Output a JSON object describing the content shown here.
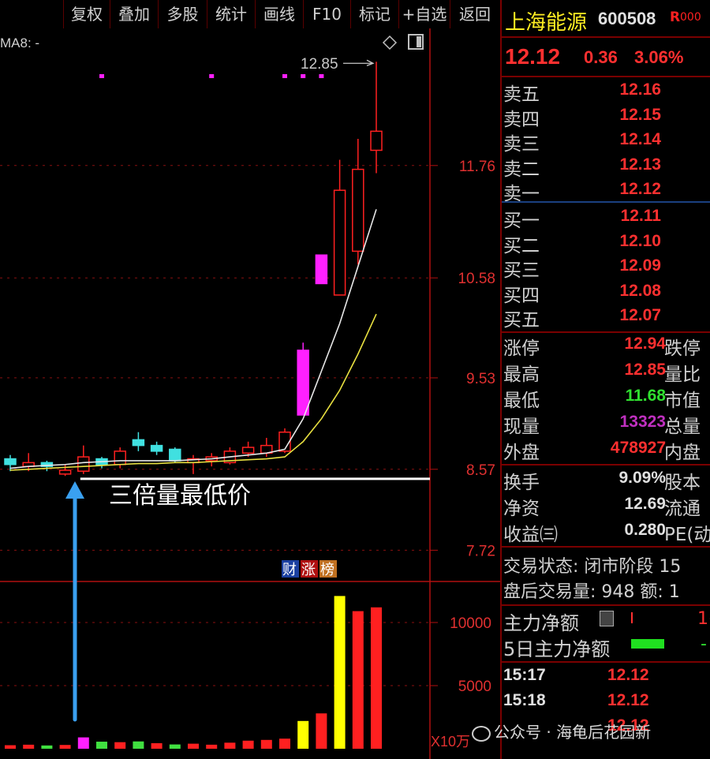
{
  "toolbar": {
    "buttons": [
      "复权",
      "叠加",
      "多股",
      "统计",
      "画线",
      "F10",
      "标记",
      "+自选",
      "返回"
    ]
  },
  "chart": {
    "ma_label": "MA8: -",
    "peak_label": "12.85",
    "price_ticks": [
      "11.76",
      "10.58",
      "9.53",
      "8.57",
      "7.72"
    ],
    "volume_ticks": [
      "10000",
      "5000"
    ],
    "volume_unit": "X10万",
    "annotation": "三倍量最低价",
    "badge": {
      "cai": "财",
      "zhang": "涨",
      "bang": "榜"
    },
    "colors": {
      "up": "#ff2020",
      "down": "#40e0e0",
      "ma_white": "#e8e8e8",
      "ma_yellow": "#e8e040",
      "volume_spike": "#ff20ff",
      "arrow": "#3aa0f0"
    }
  },
  "chart_data": {
    "type": "candlestick",
    "candles": [
      {
        "o": 8.62,
        "h": 8.72,
        "l": 8.55,
        "c": 8.68,
        "dir": "down"
      },
      {
        "o": 8.6,
        "h": 8.74,
        "l": 8.55,
        "c": 8.64,
        "dir": "up"
      },
      {
        "o": 8.64,
        "h": 8.66,
        "l": 8.55,
        "c": 8.6,
        "dir": "down"
      },
      {
        "o": 8.52,
        "h": 8.62,
        "l": 8.5,
        "c": 8.56,
        "dir": "up"
      },
      {
        "o": 8.55,
        "h": 8.82,
        "l": 8.52,
        "c": 8.7,
        "dir": "up"
      },
      {
        "o": 8.68,
        "h": 8.7,
        "l": 8.58,
        "c": 8.62,
        "dir": "down"
      },
      {
        "o": 8.62,
        "h": 8.8,
        "l": 8.58,
        "c": 8.76,
        "dir": "up"
      },
      {
        "o": 8.88,
        "h": 8.96,
        "l": 8.76,
        "c": 8.82,
        "dir": "down"
      },
      {
        "o": 8.82,
        "h": 8.86,
        "l": 8.72,
        "c": 8.76,
        "dir": "down"
      },
      {
        "o": 8.78,
        "h": 8.8,
        "l": 8.64,
        "c": 8.66,
        "dir": "down"
      },
      {
        "o": 8.64,
        "h": 8.72,
        "l": 8.52,
        "c": 8.68,
        "dir": "up"
      },
      {
        "o": 8.66,
        "h": 8.74,
        "l": 8.6,
        "c": 8.7,
        "dir": "up"
      },
      {
        "o": 8.64,
        "h": 8.8,
        "l": 8.62,
        "c": 8.76,
        "dir": "up"
      },
      {
        "o": 8.74,
        "h": 8.86,
        "l": 8.7,
        "c": 8.8,
        "dir": "up"
      },
      {
        "o": 8.74,
        "h": 8.9,
        "l": 8.7,
        "c": 8.82,
        "dir": "up"
      },
      {
        "o": 8.76,
        "h": 9.0,
        "l": 8.74,
        "c": 8.96,
        "dir": "up"
      },
      {
        "o": 9.14,
        "h": 9.9,
        "l": 9.14,
        "c": 9.82,
        "dir": "up",
        "color": "#ff20ff"
      },
      {
        "o": 10.52,
        "h": 10.82,
        "l": 10.52,
        "c": 10.82,
        "dir": "up",
        "color": "#ff20ff"
      },
      {
        "o": 10.4,
        "h": 11.82,
        "l": 10.4,
        "c": 11.5,
        "dir": "up"
      },
      {
        "o": 10.86,
        "h": 12.04,
        "l": 10.72,
        "c": 11.72,
        "dir": "up"
      },
      {
        "o": 11.92,
        "h": 12.85,
        "l": 11.68,
        "c": 12.12,
        "dir": "up"
      }
    ],
    "ma_white": [
      8.58,
      8.6,
      8.61,
      8.62,
      8.64,
      8.65,
      8.66,
      8.66,
      8.66,
      8.66,
      8.67,
      8.68,
      8.7,
      8.72,
      8.74,
      8.78,
      9.1,
      9.6,
      10.1,
      10.7,
      11.3
    ],
    "ma_yellow": [
      8.56,
      8.57,
      8.58,
      8.59,
      8.6,
      8.61,
      8.62,
      8.63,
      8.63,
      8.64,
      8.64,
      8.65,
      8.66,
      8.67,
      8.68,
      8.7,
      8.86,
      9.1,
      9.4,
      9.78,
      10.2
    ],
    "volume": [
      {
        "v": 280,
        "c": "#ff2020"
      },
      {
        "v": 320,
        "c": "#ff2020"
      },
      {
        "v": 260,
        "c": "#40e040"
      },
      {
        "v": 300,
        "c": "#ff2020"
      },
      {
        "v": 900,
        "c": "#ff20ff"
      },
      {
        "v": 560,
        "c": "#40e040"
      },
      {
        "v": 520,
        "c": "#ff2020"
      },
      {
        "v": 580,
        "c": "#40e040"
      },
      {
        "v": 440,
        "c": "#ff2020"
      },
      {
        "v": 340,
        "c": "#40e040"
      },
      {
        "v": 400,
        "c": "#ff2020"
      },
      {
        "v": 320,
        "c": "#ff2020"
      },
      {
        "v": 480,
        "c": "#ff2020"
      },
      {
        "v": 640,
        "c": "#ff2020"
      },
      {
        "v": 700,
        "c": "#ff2020"
      },
      {
        "v": 800,
        "c": "#ff2020"
      },
      {
        "v": 2200,
        "c": "#ffff00"
      },
      {
        "v": 2800,
        "c": "#ff2020"
      },
      {
        "v": 12100,
        "c": "#ffff00"
      },
      {
        "v": 10900,
        "c": "#ff2020"
      },
      {
        "v": 11200,
        "c": "#ff2020"
      }
    ],
    "price_ylim": [
      7.4,
      13.2
    ],
    "volume_ylim": [
      0,
      13000
    ],
    "support_price": 8.47
  },
  "quote": {
    "name": "上海能源",
    "code": "600508",
    "tag": "R",
    "tag2": "000",
    "price": "12.12",
    "change": "0.36",
    "pct": "3.06%",
    "asks": [
      {
        "label": "卖五",
        "price": "12.16"
      },
      {
        "label": "卖四",
        "price": "12.15"
      },
      {
        "label": "卖三",
        "price": "12.14"
      },
      {
        "label": "卖二",
        "price": "12.13"
      },
      {
        "label": "卖一",
        "price": "12.12"
      }
    ],
    "bids": [
      {
        "label": "买一",
        "price": "12.11"
      },
      {
        "label": "买二",
        "price": "12.10"
      },
      {
        "label": "买三",
        "price": "12.09"
      },
      {
        "label": "买四",
        "price": "12.08"
      },
      {
        "label": "买五",
        "price": "12.07"
      }
    ],
    "stats": [
      {
        "label": "涨停",
        "value": "12.94",
        "value_color": "#ff3030",
        "right": "跌停"
      },
      {
        "label": "最高",
        "value": "12.85",
        "value_color": "#ff3030",
        "right": "量比"
      },
      {
        "label": "最低",
        "value": "11.68",
        "value_color": "#30e030",
        "right": "市值"
      },
      {
        "label": "现量",
        "value": "13323",
        "value_color": "#c030c0",
        "right": "总量"
      },
      {
        "label": "外盘",
        "value": "478927",
        "value_color": "#ff3030",
        "right": "内盘"
      }
    ],
    "fund": [
      {
        "label": "换手",
        "value": "9.09%",
        "right": "股本"
      },
      {
        "label": "净资",
        "value": "12.69",
        "right": "流通"
      },
      {
        "label": "收益㈢",
        "value": "0.280",
        "right": "PE(动"
      }
    ],
    "trade_status": "交易状态: 闭市阶段 15",
    "after_hours": "盘后交易量: 948  额: 1",
    "main_net": "主力净额",
    "main_net_val": "1(",
    "main_net5": "5日主力净额",
    "main_net5_val": "-",
    "ticks": [
      {
        "time": "15:17",
        "price": "12.12"
      },
      {
        "time": "15:18",
        "price": "12.12"
      },
      {
        "time": "",
        "price": "12.12"
      }
    ]
  },
  "watermark": "公众号 · 海龟后花园新"
}
